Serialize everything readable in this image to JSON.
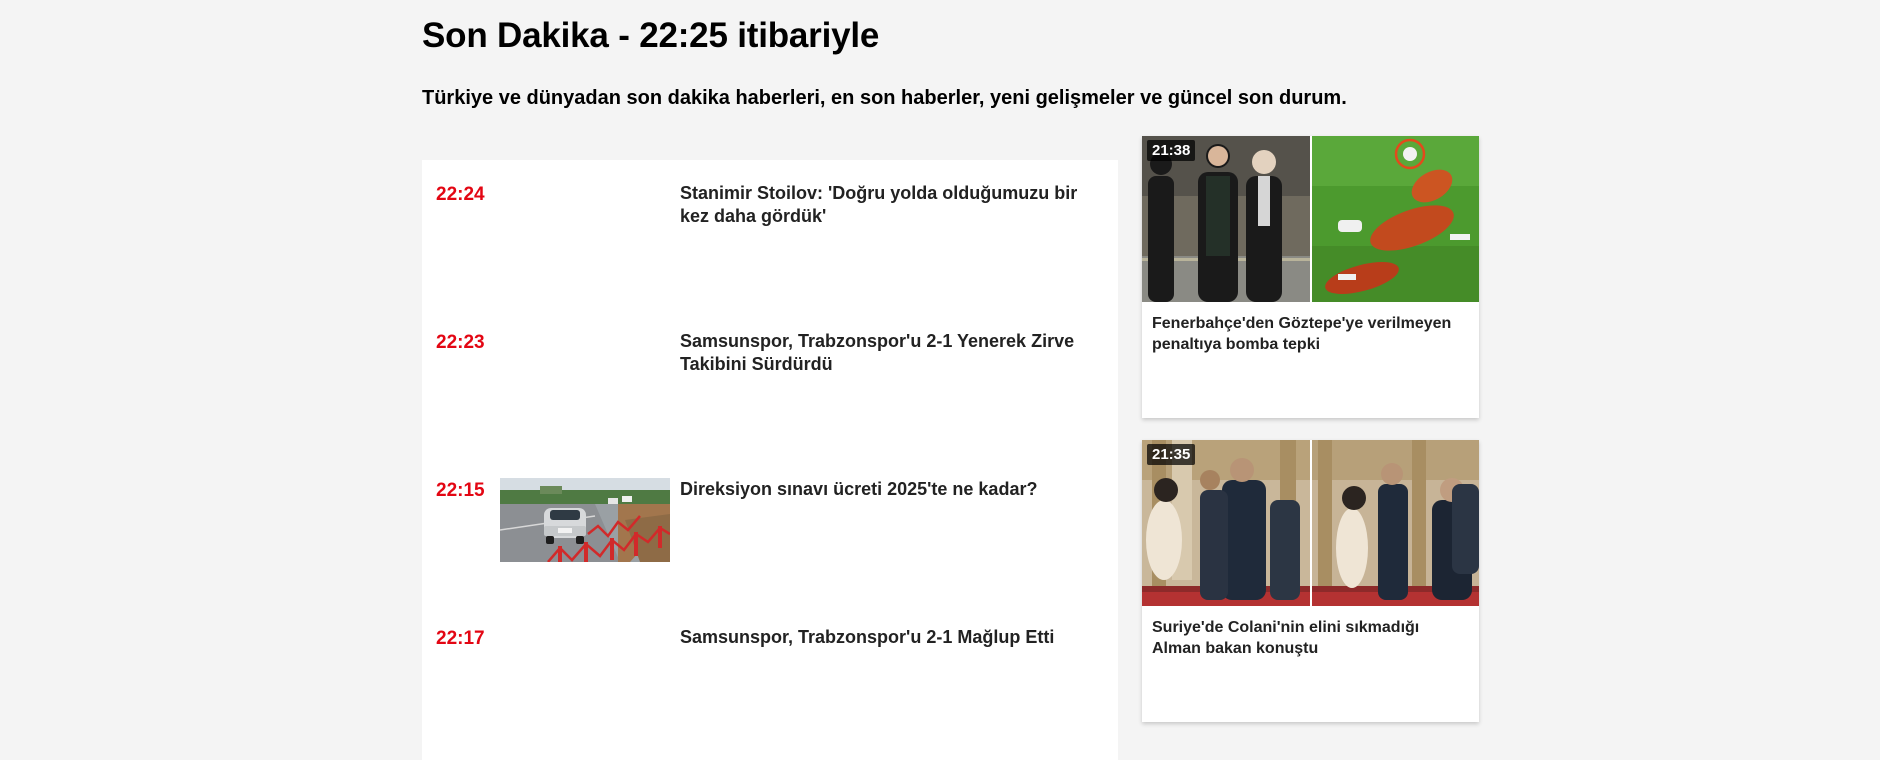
{
  "header": {
    "title": "Son Dakika - 22:25 itibariyle",
    "subtitle": "Türkiye ve dünyadan son dakika haberleri, en son haberler, yeni gelişmeler ve güncel son durum."
  },
  "news_list": [
    {
      "time": "22:24",
      "headline": "Stanimir Stoilov: 'Doğru yolda olduğumuzu bir kez daha gördük'",
      "has_image": false
    },
    {
      "time": "22:23",
      "headline": "Samsunspor, Trabzonspor'u 2-1 Yenerek Zirve Takibini Sürdürdü",
      "has_image": false
    },
    {
      "time": "22:15",
      "headline": "Direksiyon sınavı ücreti 2025'te ne kadar?",
      "has_image": true
    },
    {
      "time": "22:17",
      "headline": "Samsunspor, Trabzonspor'u 2-1 Mağlup Etti",
      "has_image": false
    }
  ],
  "side_cards": [
    {
      "time": "21:38",
      "title": "Fenerbahçe'den Göztepe'ye verilmeyen penaltıya bomba tepki"
    },
    {
      "time": "21:35",
      "title": "Suriye'de Colani'nin elini sıkmadığı Alman bakan konuştu"
    }
  ],
  "colors": {
    "time_accent": "#e30613",
    "background": "#f4f4f4"
  }
}
